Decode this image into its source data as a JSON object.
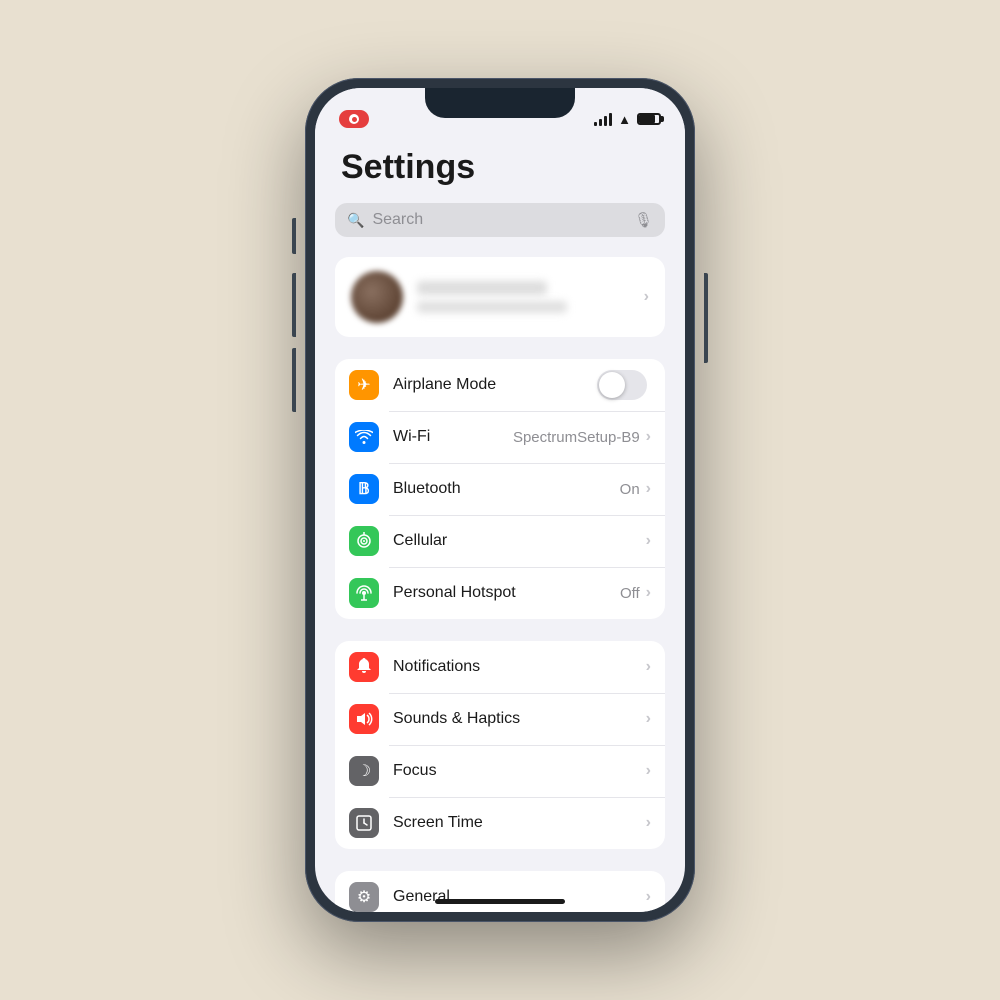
{
  "page": {
    "title": "Settings",
    "background": "#e8e0d0"
  },
  "search": {
    "placeholder": "Search"
  },
  "statusBar": {
    "wifi_network": "SpectrumSetup-B9"
  },
  "profile": {
    "chevron": "›"
  },
  "group1": {
    "items": [
      {
        "id": "airplane-mode",
        "label": "Airplane Mode",
        "icon": "✈",
        "iconClass": "icon-orange",
        "hasToggle": true,
        "value": "",
        "chevron": ""
      },
      {
        "id": "wifi",
        "label": "Wi-Fi",
        "icon": "📶",
        "iconClass": "icon-blue",
        "hasToggle": false,
        "value": "SpectrumSetup-B9",
        "chevron": "›"
      },
      {
        "id": "bluetooth",
        "label": "Bluetooth",
        "icon": "B",
        "iconClass": "icon-blue-dark",
        "hasToggle": false,
        "value": "On",
        "chevron": "›"
      },
      {
        "id": "cellular",
        "label": "Cellular",
        "icon": "((·))",
        "iconClass": "icon-green",
        "hasToggle": false,
        "value": "",
        "chevron": "›"
      },
      {
        "id": "hotspot",
        "label": "Personal Hotspot",
        "icon": "⁂",
        "iconClass": "icon-green2",
        "hasToggle": false,
        "value": "Off",
        "chevron": "›"
      }
    ]
  },
  "group2": {
    "items": [
      {
        "id": "notifications",
        "label": "Notifications",
        "icon": "🔔",
        "iconClass": "icon-red",
        "hasToggle": false,
        "value": "",
        "chevron": "›"
      },
      {
        "id": "sounds",
        "label": "Sounds & Haptics",
        "icon": "🔈",
        "iconClass": "icon-red2",
        "hasToggle": false,
        "value": "",
        "chevron": "›"
      },
      {
        "id": "focus",
        "label": "Focus",
        "icon": "☽",
        "iconClass": "icon-gray",
        "hasToggle": false,
        "value": "",
        "chevron": "›"
      },
      {
        "id": "screentime",
        "label": "Screen Time",
        "icon": "⏳",
        "iconClass": "icon-gray2",
        "hasToggle": false,
        "value": "",
        "chevron": "›"
      }
    ]
  },
  "group3": {
    "items": [
      {
        "id": "general",
        "label": "General",
        "icon": "⚙",
        "iconClass": "icon-gray3",
        "hasToggle": false,
        "value": "",
        "chevron": "›"
      }
    ]
  },
  "chevronChar": "›"
}
